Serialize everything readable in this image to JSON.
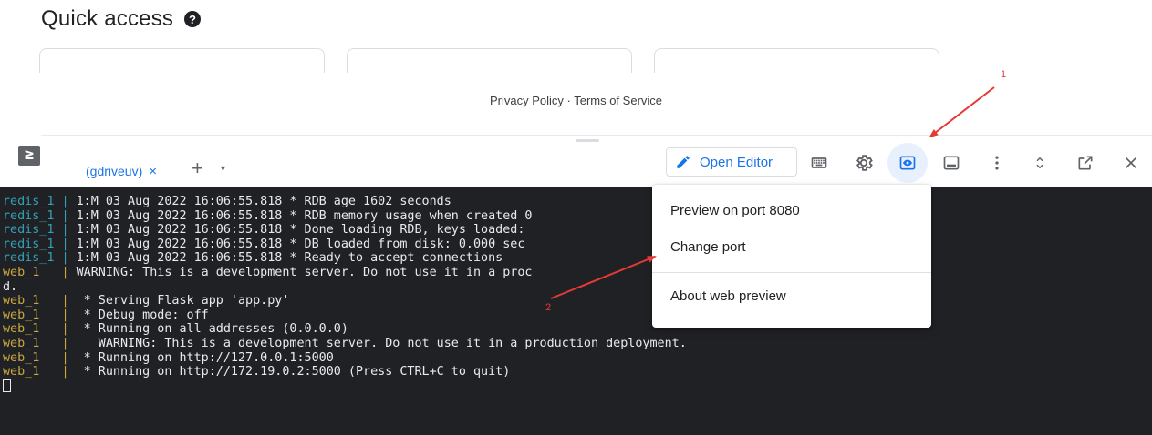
{
  "page": {
    "title": "Quick access",
    "help_glyph": "?",
    "footer": "Privacy Policy · Terms of Service"
  },
  "shell": {
    "logo_glyph": "≥",
    "tab_label": "(gdriveuv)",
    "tab_close": "×",
    "add_tab": "+",
    "tab_menu": "▼",
    "toolbar": {
      "open_editor": "Open Editor",
      "icons": [
        "keyboard-icon",
        "gear-icon",
        "web-preview-icon",
        "minimize-panel-icon",
        "more-vert-icon",
        "expand-collapse-icon",
        "open-new-window-icon",
        "close-icon"
      ]
    }
  },
  "terminal": {
    "lines": [
      {
        "svc": "redis_1",
        "sep": " | ",
        "text": "1:M 03 Aug 2022 16:06:55.818 * RDB age 1602 seconds"
      },
      {
        "svc": "redis_1",
        "sep": " | ",
        "text": "1:M 03 Aug 2022 16:06:55.818 * RDB memory usage when created 0"
      },
      {
        "svc": "redis_1",
        "sep": " | ",
        "text": "1:M 03 Aug 2022 16:06:55.818 * Done loading RDB, keys loaded: "
      },
      {
        "svc": "redis_1",
        "sep": " | ",
        "text": "1:M 03 Aug 2022 16:06:55.818 * DB loaded from disk: 0.000 sec"
      },
      {
        "svc": "redis_1",
        "sep": " | ",
        "text": "1:M 03 Aug 2022 16:06:55.818 * Ready to accept connections"
      },
      {
        "svc": "web_1",
        "sep": "   | ",
        "text": "WARNING: This is a development server. Do not use it in a proc                            tion WSGI server instea"
      },
      {
        "svc": "",
        "sep": "",
        "text": "d."
      },
      {
        "svc": "web_1",
        "sep": "   | ",
        "text": " * Serving Flask app 'app.py'"
      },
      {
        "svc": "web_1",
        "sep": "   | ",
        "text": " * Debug mode: off"
      },
      {
        "svc": "web_1",
        "sep": "   | ",
        "text": " * Running on all addresses (0.0.0.0)"
      },
      {
        "svc": "web_1",
        "sep": "   | ",
        "text": "   WARNING: This is a development server. Do not use it in a production deployment."
      },
      {
        "svc": "web_1",
        "sep": "   | ",
        "text": " * Running on http://127.0.0.1:5000"
      },
      {
        "svc": "web_1",
        "sep": "   | ",
        "text": " * Running on http://172.19.0.2:5000 (Press CTRL+C to quit)"
      }
    ]
  },
  "menu": {
    "preview": "Preview on port 8080",
    "change_port": "Change port",
    "about": "About web preview"
  },
  "annotations": {
    "label1": "1",
    "label2": "2"
  },
  "colors": {
    "accent": "#1a73e8",
    "terminal_bg": "#202124",
    "redis_tag": "#34a0b5",
    "web_tag": "#c8a73f",
    "annotation": "#e53935"
  }
}
